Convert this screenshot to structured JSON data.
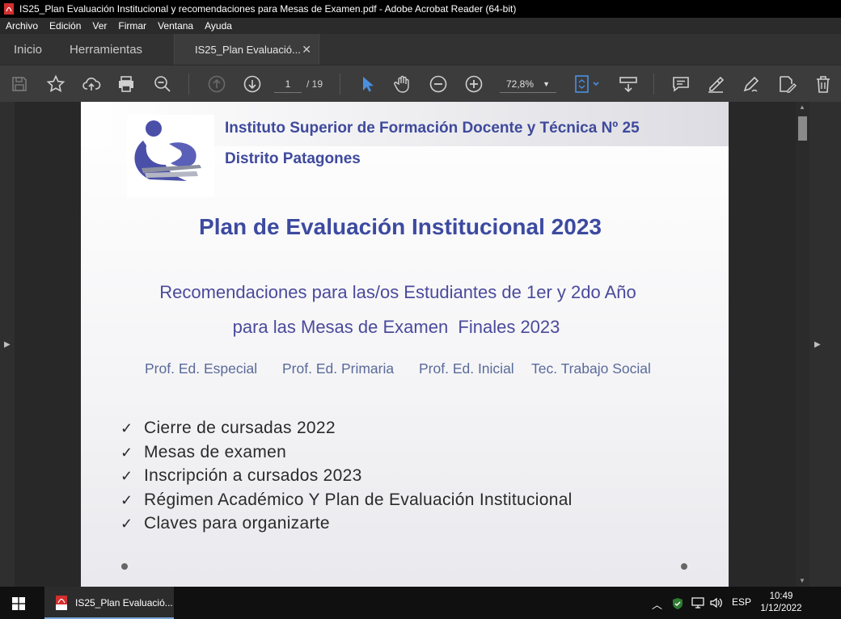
{
  "window": {
    "title": "IS25_Plan Evaluación Institucional y recomendaciones para Mesas de Examen.pdf - Adobe Acrobat Reader (64-bit)"
  },
  "menu": [
    "Archivo",
    "Edición",
    "Ver",
    "Firmar",
    "Ventana",
    "Ayuda"
  ],
  "tabs": {
    "home": "Inicio",
    "tools": "Herramientas",
    "document": "IS25_Plan Evaluació..."
  },
  "toolbar": {
    "current_page": "1",
    "page_total": "/ 19",
    "zoom": "72,8%"
  },
  "document": {
    "institute_line1": "Instituto Superior de Formación Docente y Técnica Nº 25",
    "institute_line2": "Distrito Patagones",
    "title": "Plan de Evaluación Institucional 2023",
    "subtitle_line1": "Recomendaciones para las/os Estudiantes de 1er y 2do Año",
    "subtitle_line2": "para las Mesas de Examen  Finales 2023",
    "careers": [
      "Prof. Ed. Especial",
      "Prof. Ed. Primaria",
      "Prof. Ed. Inicial",
      "Tec. Trabajo Social"
    ],
    "bullets": [
      "Cierre de cursadas 2022",
      "Mesas de examen",
      "Inscripción a cursados 2023",
      "Régimen Académico Y Plan de Evaluación Institucional",
      "Claves para organizarte"
    ],
    "bullet_mark": "✓"
  },
  "taskbar": {
    "app_label": "IS25_Plan Evaluació...",
    "language": "ESP",
    "time": "10:49",
    "date": "1/12/2022"
  },
  "colors": {
    "accent_blue": "#3f4a9c",
    "select_tool": "#4a90e2",
    "pdf_red": "#d32f2f"
  }
}
